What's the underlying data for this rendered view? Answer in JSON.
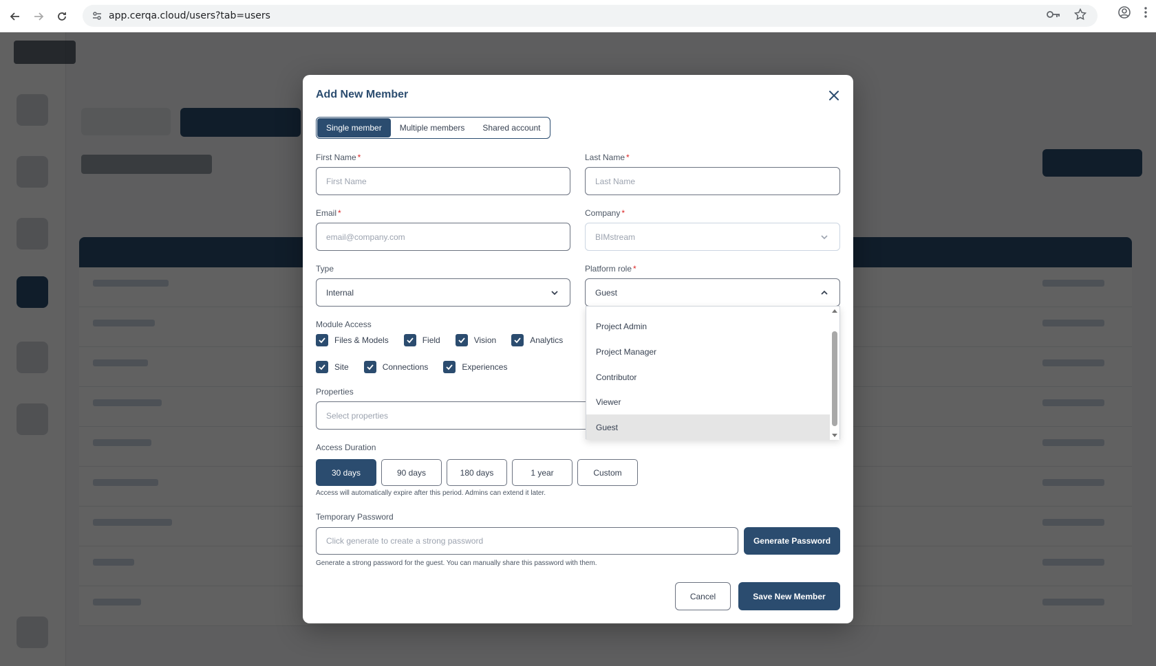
{
  "browser": {
    "url": "app.cerqa.cloud/users?tab=users"
  },
  "modal": {
    "title": "Add New Member",
    "tabs": [
      {
        "label": "Single member",
        "active": true
      },
      {
        "label": "Multiple members",
        "active": false
      },
      {
        "label": "Shared account",
        "active": false
      }
    ],
    "first_name": {
      "label": "First Name",
      "required": "*",
      "placeholder": "First Name",
      "value": ""
    },
    "last_name": {
      "label": "Last Name",
      "required": "*",
      "placeholder": "Last Name",
      "value": ""
    },
    "email": {
      "label": "Email",
      "required": "*",
      "placeholder": "email@company.com",
      "value": ""
    },
    "company": {
      "label": "Company",
      "required": "*",
      "value": "BIMstream"
    },
    "type": {
      "label": "Type",
      "value": "Internal"
    },
    "platform_role": {
      "label": "Platform role",
      "required": "*",
      "value": "Guest",
      "options": [
        "Project Admin",
        "Project Manager",
        "Contributor",
        "Viewer",
        "Guest"
      ],
      "selected": "Guest"
    },
    "module_access": {
      "label": "Module Access",
      "modules": [
        {
          "label": "Files & Models",
          "checked": true
        },
        {
          "label": "Field",
          "checked": true
        },
        {
          "label": "Vision",
          "checked": true
        },
        {
          "label": "Analytics",
          "checked": true
        },
        {
          "label": "Site",
          "checked": true
        },
        {
          "label": "Connections",
          "checked": true
        },
        {
          "label": "Experiences",
          "checked": true
        }
      ]
    },
    "properties": {
      "label": "Properties",
      "placeholder": "Select properties"
    },
    "access_duration": {
      "label": "Access Duration",
      "options": [
        "30 days",
        "90 days",
        "180 days",
        "1 year",
        "Custom"
      ],
      "selected": "30 days",
      "hint": "Access will automatically expire after this period. Admins can extend it later."
    },
    "temp_password": {
      "label": "Temporary Password",
      "placeholder": "Click generate to create a strong password",
      "generate_label": "Generate Password",
      "hint": "Generate a strong password for the guest. You can manually share this password with them."
    },
    "cancel_label": "Cancel",
    "save_label": "Save New Member"
  },
  "colors": {
    "primary": "#2b4c6f",
    "required": "#dc2626",
    "overlay": "rgba(0,0,0,0.62)"
  }
}
